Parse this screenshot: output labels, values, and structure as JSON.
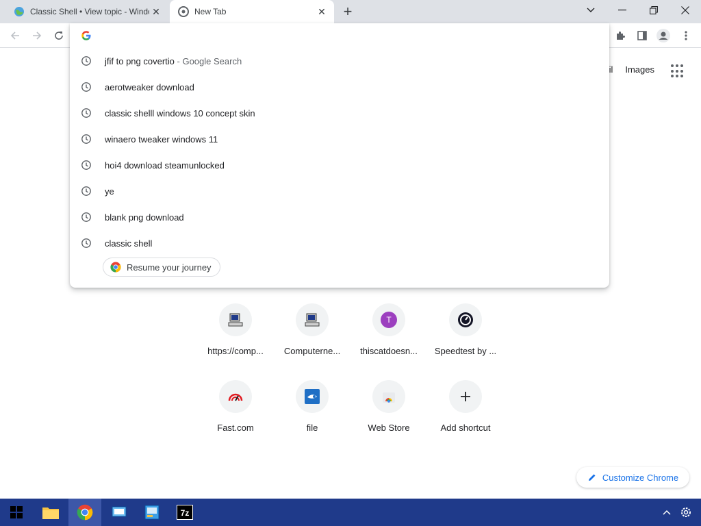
{
  "browser": {
    "tabs": [
      {
        "title": "Classic Shell • View topic - Windows",
        "active": false
      },
      {
        "title": "New Tab",
        "active": true
      }
    ]
  },
  "omnibox": {
    "value": "",
    "suggestions": [
      {
        "text": "jfif to png covertio",
        "description": "- Google Search"
      },
      {
        "text": "aerotweaker download",
        "description": ""
      },
      {
        "text": "classic shelll windows 10 concept skin",
        "description": ""
      },
      {
        "text": "winaero tweaker windows 11",
        "description": ""
      },
      {
        "text": "hoi4 download steamunlocked",
        "description": ""
      },
      {
        "text": "ye",
        "description": ""
      },
      {
        "text": "blank png download",
        "description": ""
      },
      {
        "text": "classic shell",
        "description": ""
      }
    ],
    "resume_journey_label": "Resume your journey"
  },
  "page": {
    "gmail_partial": "il",
    "images_label": "Images",
    "shortcuts": [
      {
        "label": "https://comp...",
        "icon": "computer-icon"
      },
      {
        "label": "Computerne...",
        "icon": "computer-icon"
      },
      {
        "label": "thiscatdoesn...",
        "icon": "letter-avatar-icon",
        "letter": "T"
      },
      {
        "label": "Speedtest by ...",
        "icon": "speedtest-icon"
      },
      {
        "label": "Fast.com",
        "icon": "fast-com-icon"
      },
      {
        "label": "file",
        "icon": "mediafire-icon"
      },
      {
        "label": "Web Store",
        "icon": "web-store-icon"
      },
      {
        "label": "Add shortcut",
        "icon": "plus-icon"
      }
    ],
    "customize_label": "Customize Chrome"
  },
  "taskbar": {
    "apps": [
      "start",
      "file-explorer",
      "chrome",
      "app-3",
      "app-4",
      "7zip"
    ],
    "colors": {
      "background": "#1f3a8a",
      "active": "#3d57a8"
    }
  }
}
